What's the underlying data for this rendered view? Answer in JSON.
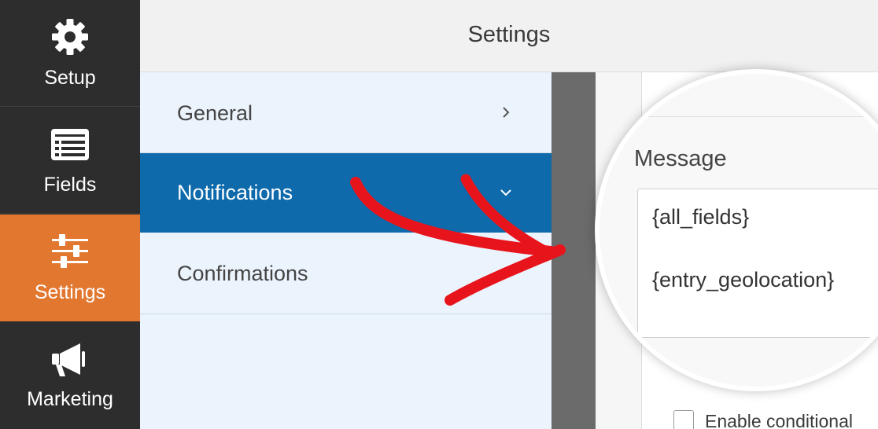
{
  "sidebar": {
    "items": [
      {
        "label": "Setup",
        "icon": "gear-icon",
        "active": false
      },
      {
        "label": "Fields",
        "icon": "list-icon",
        "active": false
      },
      {
        "label": "Settings",
        "icon": "sliders-icon",
        "active": true
      },
      {
        "label": "Marketing",
        "icon": "megaphone-icon",
        "active": false
      }
    ],
    "active_color": "#e27730",
    "background_color": "#2d2d2d"
  },
  "header": {
    "title": "Settings"
  },
  "settings_nav": {
    "items": [
      {
        "label": "General",
        "chevron": "chevron-right-icon",
        "active": false
      },
      {
        "label": "Notifications",
        "chevron": "chevron-down-icon",
        "active": true
      },
      {
        "label": "Confirmations",
        "chevron": "",
        "active": false
      }
    ],
    "active_color": "#0e6aab"
  },
  "notification_panel": {
    "message_label": "Message",
    "message_lines": [
      "{all_fields}",
      "{entry_geolocation}"
    ],
    "conditional_logic_label": "Enable conditional"
  },
  "annotation": {
    "arrow_color": "#e8141b"
  }
}
